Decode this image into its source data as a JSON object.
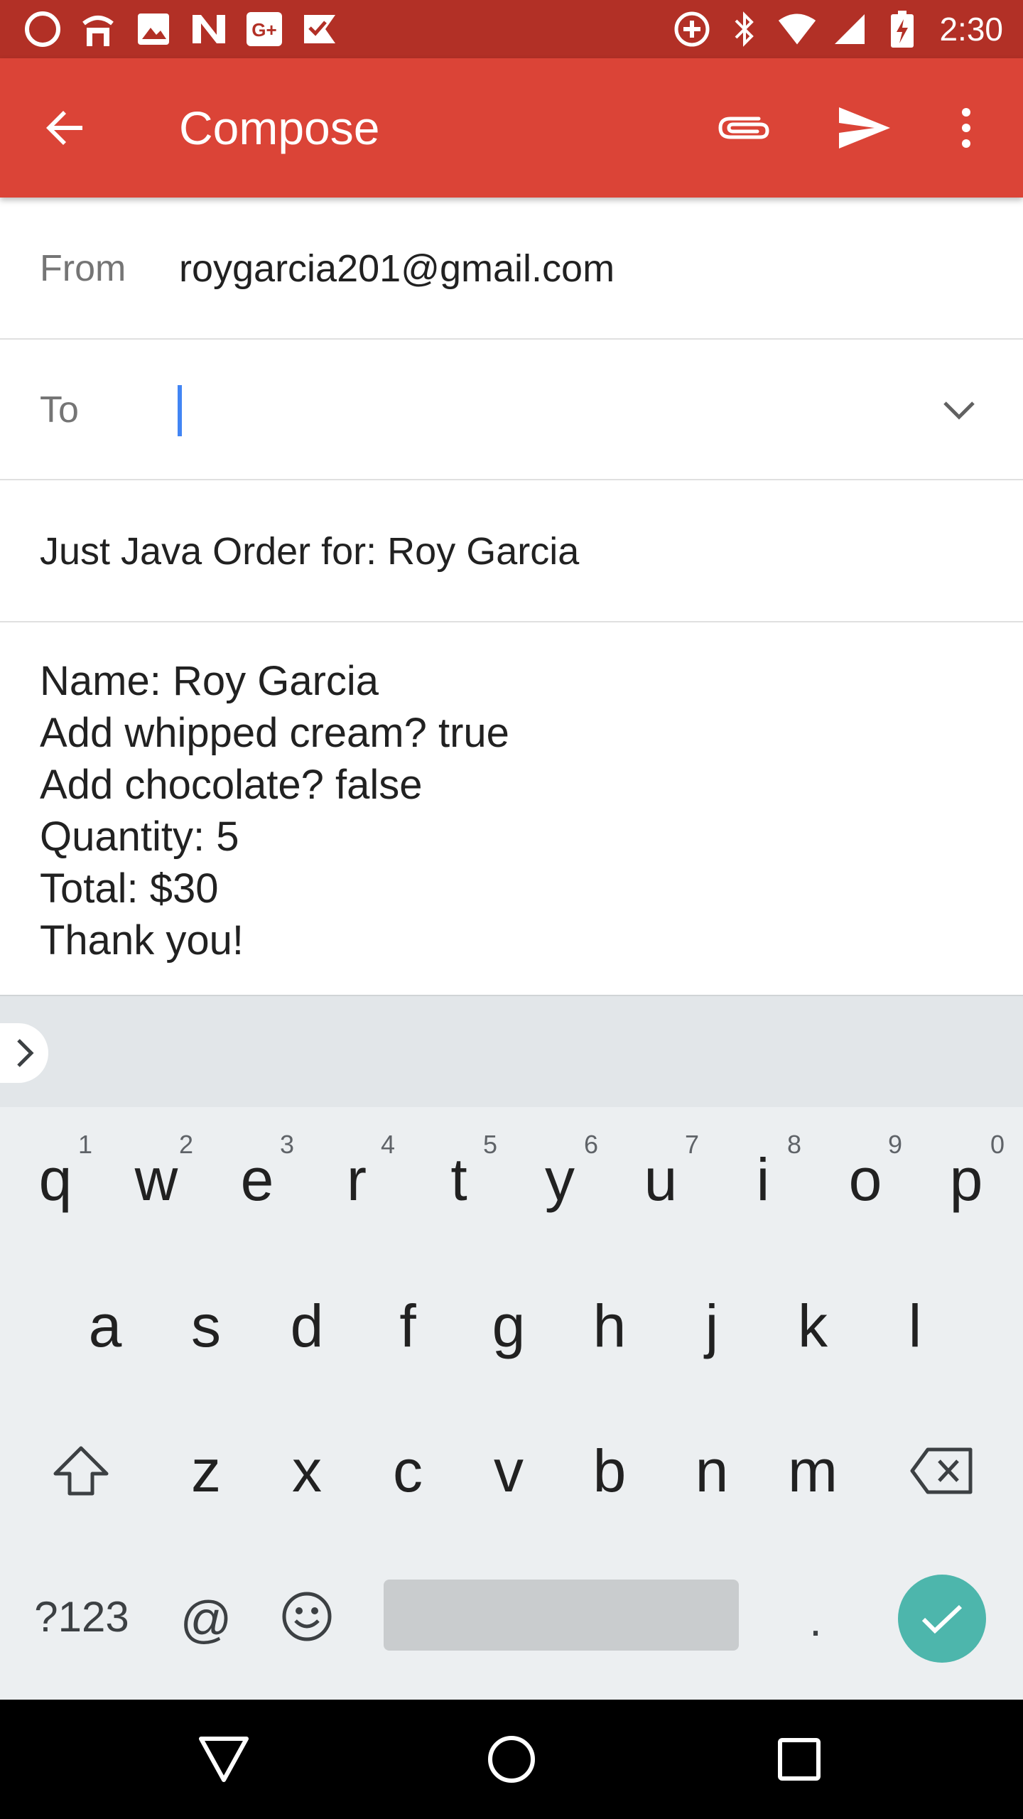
{
  "status_bar": {
    "time": "2:30"
  },
  "app_bar": {
    "title": "Compose"
  },
  "compose": {
    "from_label": "From",
    "from_value": "roygarcia201@gmail.com",
    "to_label": "To",
    "to_value": "",
    "subject": "Just Java Order for: Roy Garcia",
    "body_lines": [
      "Name: Roy Garcia",
      "Add whipped cream? true",
      "Add chocolate? false",
      "Quantity: 5",
      "Total: $30",
      "Thank you!"
    ]
  },
  "keyboard": {
    "row1": [
      "q",
      "w",
      "e",
      "r",
      "t",
      "y",
      "u",
      "i",
      "o",
      "p"
    ],
    "row1_hints": [
      "1",
      "2",
      "3",
      "4",
      "5",
      "6",
      "7",
      "8",
      "9",
      "0"
    ],
    "row2": [
      "a",
      "s",
      "d",
      "f",
      "g",
      "h",
      "j",
      "k",
      "l"
    ],
    "row3": [
      "z",
      "x",
      "c",
      "v",
      "b",
      "n",
      "m"
    ],
    "symbols_label": "?123",
    "at_label": "@",
    "period_label": "."
  },
  "colors": {
    "status_bar": "#b23026",
    "app_bar": "#db4437",
    "cursor": "#4285f4",
    "enter_key": "#4db6ac",
    "keyboard_bg": "#eceff1"
  }
}
